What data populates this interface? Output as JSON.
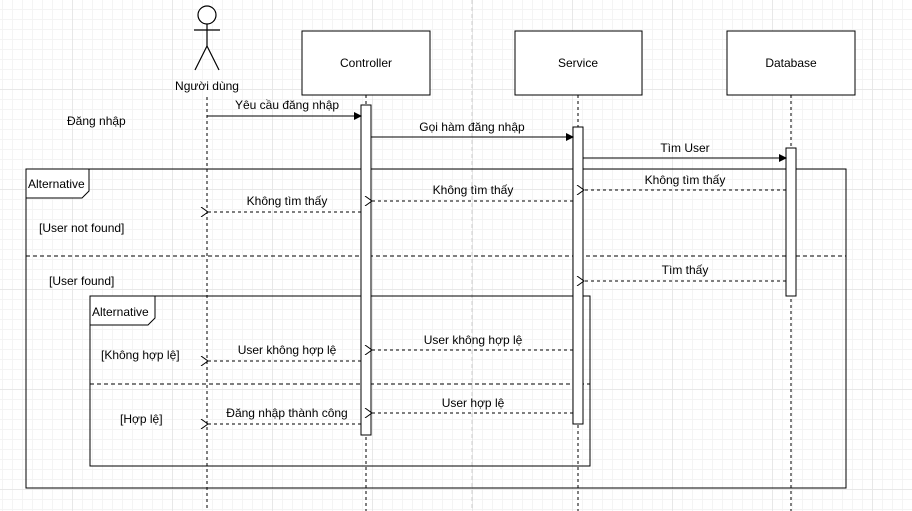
{
  "participants": {
    "actor": "Người dùng",
    "controller": "Controller",
    "service": "Service",
    "database": "Database"
  },
  "side_label": "Đăng nhập",
  "messages": {
    "m1": "Yêu cầu đăng nhập",
    "m2": "Gọi hàm đăng nhập",
    "m3": "Tìm User",
    "m4": "Không tìm thấy",
    "m5": "Không tìm thấy",
    "m6": "Không tìm thấy",
    "m7": "Tìm thấy",
    "m8": "User không hợp lệ",
    "m9": "User không hợp lệ",
    "m10": "User hợp lệ",
    "m11": "Đăng nhập thành công"
  },
  "fragments": {
    "outer_label": "Alternative",
    "outer_guard_1": "[User not found]",
    "outer_guard_2": "[User found]",
    "inner_label": "Alternative",
    "inner_guard_1": "[Không hợp lệ]",
    "inner_guard_2": "[Hợp lệ]"
  },
  "colors": {
    "line": "#000000",
    "grid": "#e8e8e8",
    "background": "#ffffff"
  }
}
